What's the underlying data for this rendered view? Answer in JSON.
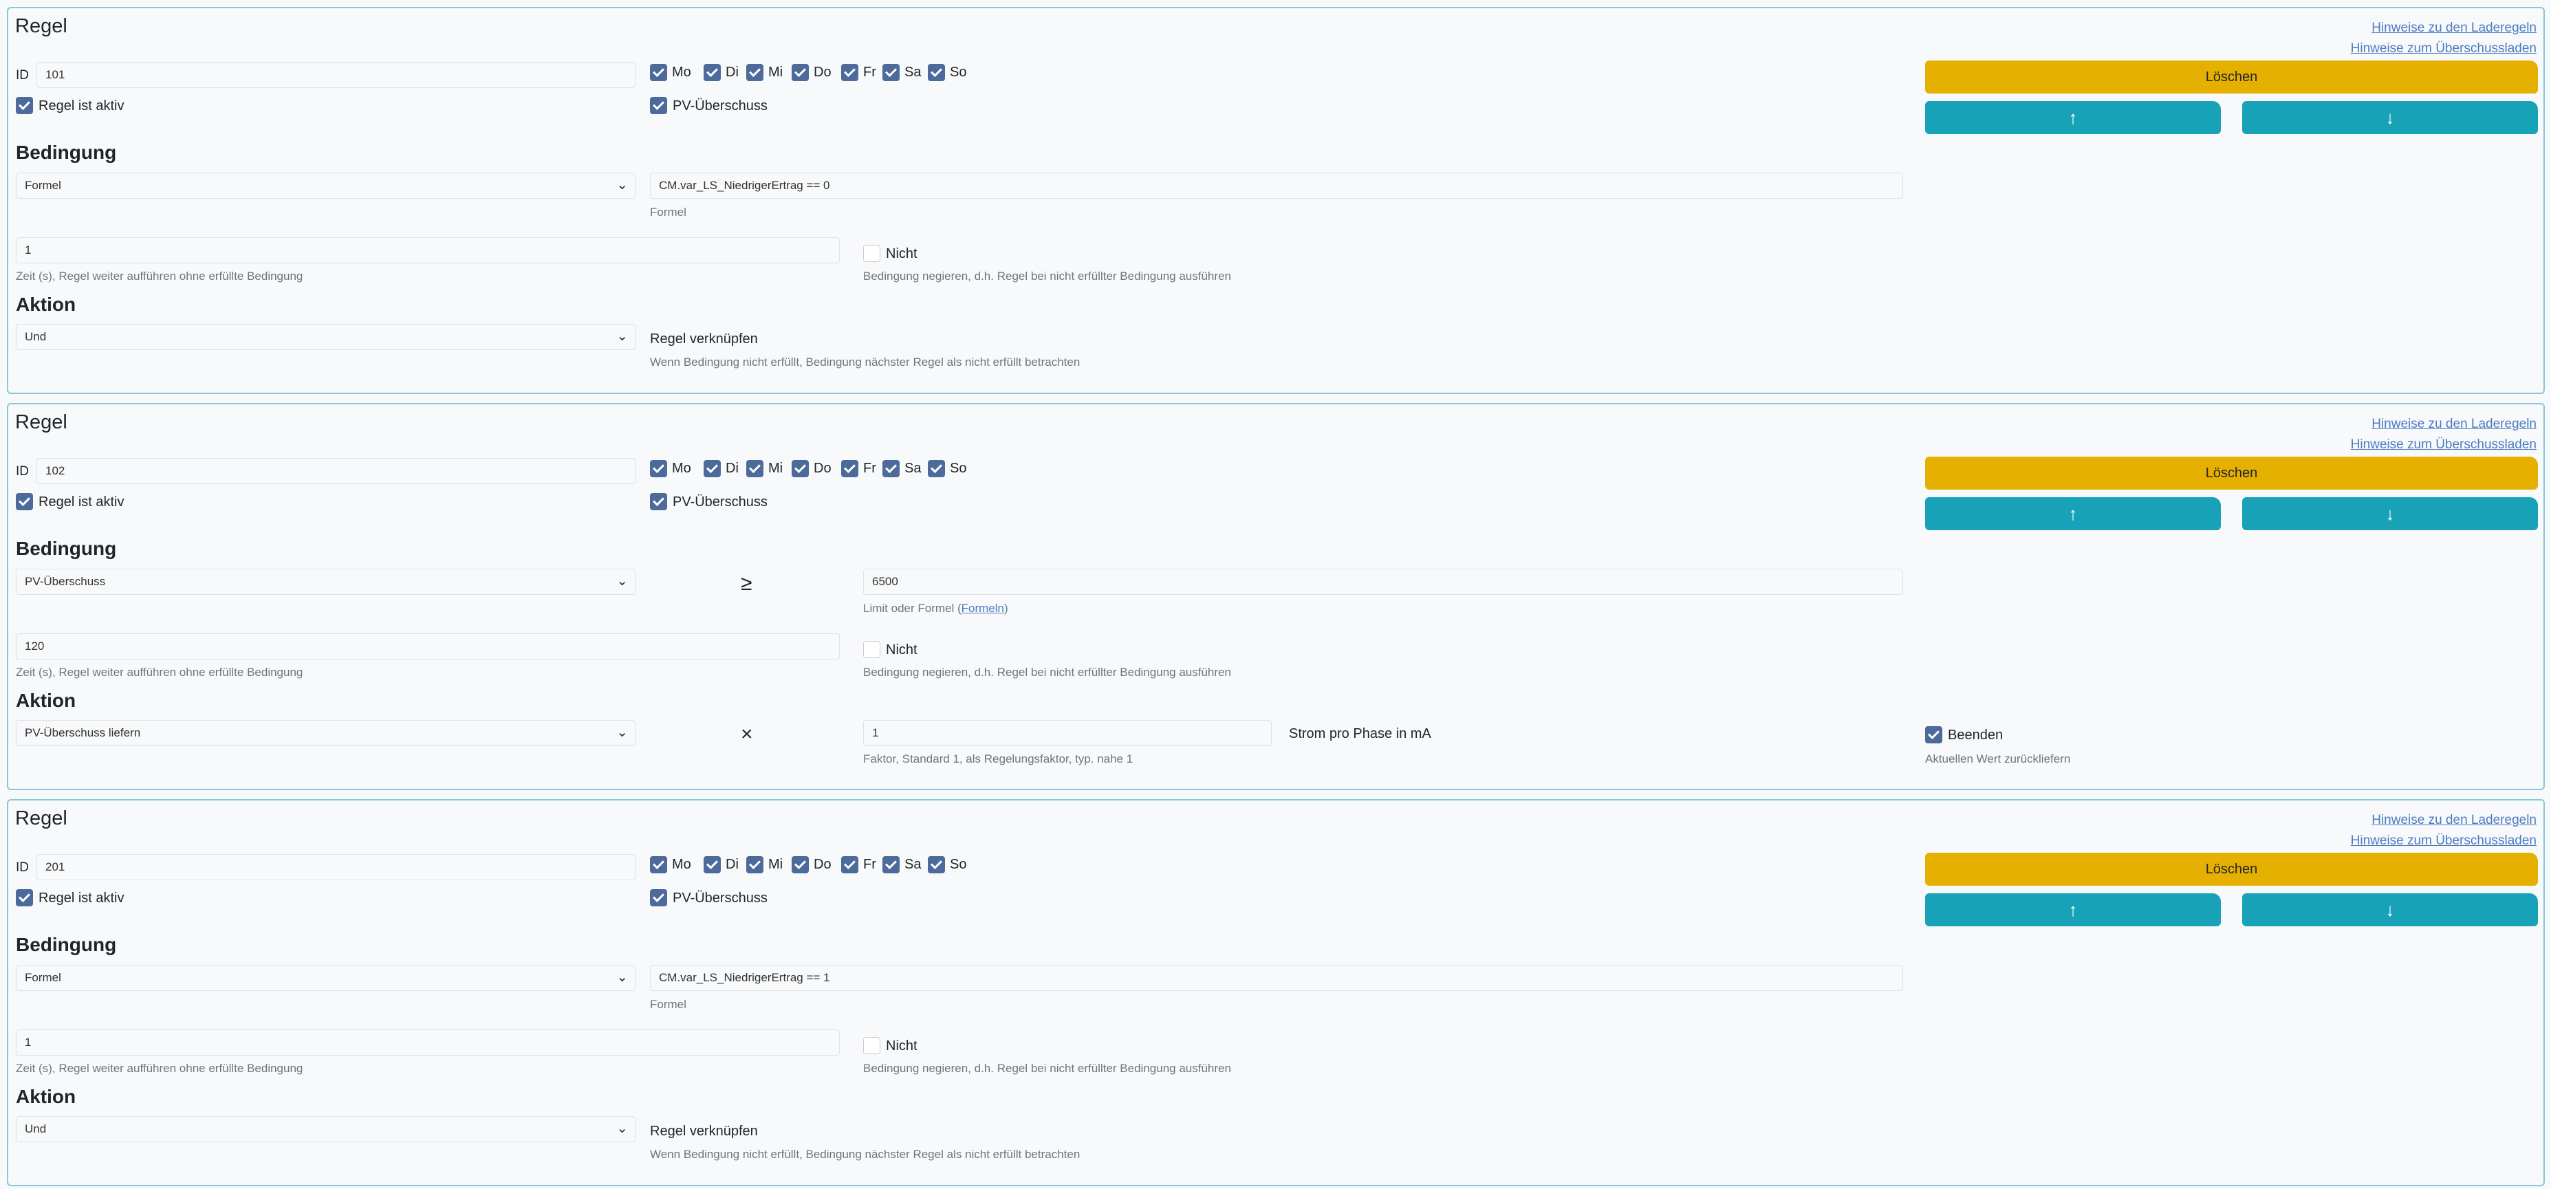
{
  "common": {
    "rule_heading": "Regel",
    "link_laderegeln": "Hinweise zu den Laderegeln",
    "link_ueberschuss": "Hinweise zum Überschussladen",
    "id_label": "ID",
    "active_label": "Regel ist aktiv",
    "pv_label": "PV-Überschuss",
    "delete_label": "Löschen",
    "up_icon": "arrow-up-icon",
    "down_icon": "arrow-down-icon",
    "condition_heading": "Bedingung",
    "action_heading": "Aktion",
    "formula_help": "Formel",
    "time_help": "Zeit (s), Regel weiter aufführen ohne erfüllte Bedingung",
    "not_label": "Nicht",
    "not_help": "Bedingung negieren, d.h. Regel bei nicht erfüllter Bedingung ausführen",
    "link_rule_label": "Regel verknüpfen",
    "link_rule_help": "Wenn Bedingung nicht erfüllt, Bedingung nächster Regel als nicht erfüllt betrachten",
    "days": [
      "Mo",
      "Di",
      "Mi",
      "Do",
      "Fr",
      "Sa",
      "So"
    ],
    "colors": {
      "delete": "#e6b000",
      "move": "#17a2b8",
      "checkbox": "#4c6a9a",
      "border": "#86c8d6",
      "link": "#4a7bc4"
    }
  },
  "rules": [
    {
      "id": "101",
      "active": true,
      "pv": true,
      "days_checked": [
        true,
        true,
        true,
        true,
        true,
        true,
        true
      ],
      "condition_type": "Formel",
      "formula": "CM.var_LS_NiedrigerErtrag == 0",
      "time": "1",
      "not_checked": false,
      "action_type": "Und"
    },
    {
      "id": "102",
      "active": true,
      "pv": true,
      "days_checked": [
        true,
        true,
        true,
        true,
        true,
        true,
        true
      ],
      "condition_type": "PV-Überschuss",
      "operator": "≥",
      "limit": "6500",
      "limit_help_prefix": "Limit oder Formel (",
      "limit_help_link": "Formeln",
      "limit_help_suffix": ")",
      "time": "120",
      "not_checked": false,
      "action_type": "PV-Überschuss liefern",
      "action_operator": "×",
      "factor": "1",
      "factor_help": "Faktor, Standard 1, als Regelungsfaktor, typ. nahe 1",
      "unit_label": "Strom pro Phase in mA",
      "finish_label": "Beenden",
      "finish_checked": true,
      "finish_help": "Aktuellen Wert zurückliefern"
    },
    {
      "id": "201",
      "active": true,
      "pv": true,
      "days_checked": [
        true,
        true,
        true,
        true,
        true,
        true,
        true
      ],
      "condition_type": "Formel",
      "formula": "CM.var_LS_NiedrigerErtrag == 1",
      "time": "1",
      "not_checked": false,
      "action_type": "Und"
    }
  ]
}
